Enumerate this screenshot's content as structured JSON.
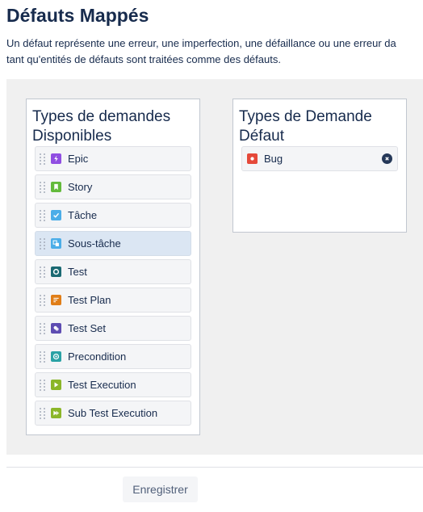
{
  "page": {
    "title": "Défauts Mappés",
    "description_line1": "Un défaut représente une erreur, une imperfection, une défaillance ou une erreur da",
    "description_line2": "tant qu'entités de défauts sont traitées comme des défauts."
  },
  "available": {
    "title": "Types de demandes Disponibles",
    "items": [
      {
        "label": "Epic",
        "icon": "epic-icon",
        "color": "#904ee2",
        "selected": false
      },
      {
        "label": "Story",
        "icon": "story-icon",
        "color": "#63ba3c",
        "selected": false
      },
      {
        "label": "Tâche",
        "icon": "task-icon",
        "color": "#4bade8",
        "selected": false
      },
      {
        "label": "Sous-tâche",
        "icon": "subtask-icon",
        "color": "#4bade8",
        "selected": true
      },
      {
        "label": "Test",
        "icon": "test-icon",
        "color": "#1b6a73",
        "selected": false
      },
      {
        "label": "Test Plan",
        "icon": "test-plan-icon",
        "color": "#e07e18",
        "selected": false
      },
      {
        "label": "Test Set",
        "icon": "test-set-icon",
        "color": "#5e4db2",
        "selected": false
      },
      {
        "label": "Precondition",
        "icon": "precondition-icon",
        "color": "#2aa2a5",
        "selected": false
      },
      {
        "label": "Test Execution",
        "icon": "test-execution-icon",
        "color": "#8bb629",
        "selected": false
      },
      {
        "label": "Sub Test Execution",
        "icon": "sub-test-execution-icon",
        "color": "#8bb629",
        "selected": false
      }
    ]
  },
  "mapped": {
    "title": "Types de Demande Défaut",
    "items": [
      {
        "label": "Bug",
        "icon": "bug-icon",
        "color": "#e5493a"
      }
    ]
  },
  "footer": {
    "save_label": "Enregistrer"
  }
}
